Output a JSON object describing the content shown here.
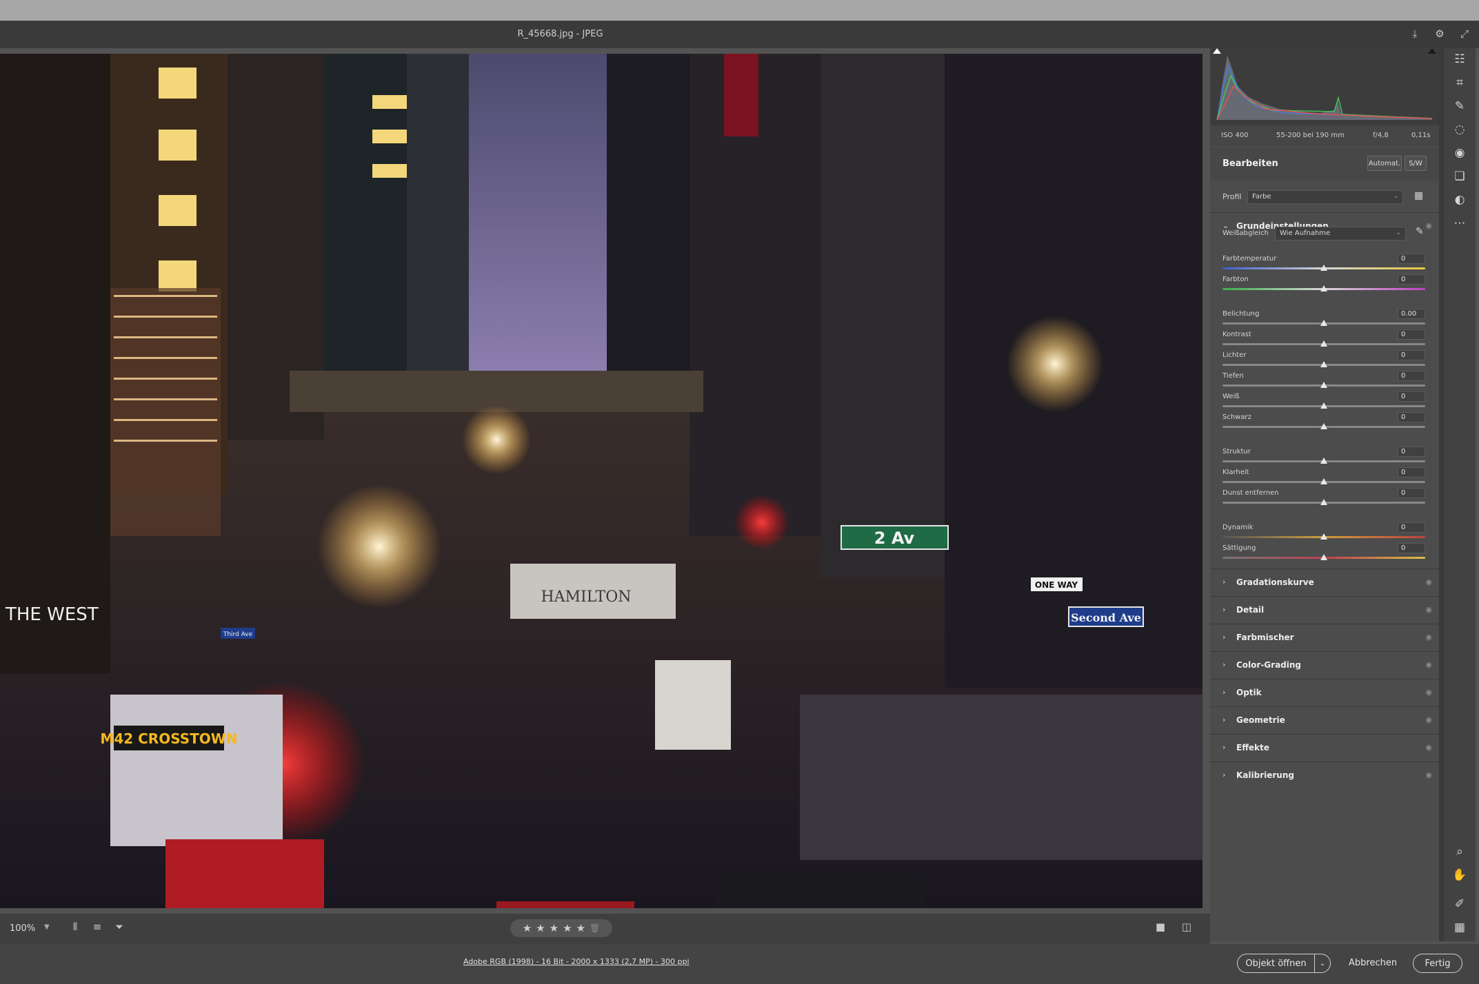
{
  "window": {
    "title": "R_45668.jpg - JPEG",
    "icons": [
      "save-icon",
      "gear-icon",
      "expand-icon"
    ]
  },
  "photo": {
    "signs": {
      "street": "2 Av",
      "avenue": "Second Ave",
      "bus": "M42 CROSSTOWN",
      "oneway": "ONE WAY",
      "bus_company": "HAMILTON",
      "third_ave": "Third Ave",
      "store": "THE WEST"
    }
  },
  "bottom_toolbar": {
    "zoom": "100%",
    "icons": [
      "filmstrip-icon",
      "sort-icon",
      "filter-icon",
      "single-view-icon",
      "compare-icon"
    ],
    "rating": {
      "max": 5,
      "value": 0
    }
  },
  "footer": {
    "info": "Adobe RGB (1998) - 16 Bit - 2000 x 1333 (2,7 MP) - 300 ppi",
    "open": "Objekt öffnen",
    "cancel": "Abbrechen",
    "done": "Fertig"
  },
  "exif": {
    "iso": "ISO 400",
    "lens": "55-200 bei 190 mm",
    "aperture": "f/4,8",
    "shutter": "0,11s"
  },
  "edit": {
    "title": "Bearbeiten",
    "auto": "Automat.",
    "bw": "S/W",
    "profile_label": "Profil",
    "profile_value": "Farbe",
    "basic": {
      "title": "Grundeinstellungen",
      "wb_label": "Weißabgleich",
      "wb_value": "Wie Aufnahme",
      "sliders": [
        {
          "label": "Farbtemperatur",
          "value": "0"
        },
        {
          "label": "Farbton",
          "value": "0"
        },
        {
          "label": "Belichtung",
          "value": "0.00"
        },
        {
          "label": "Kontrast",
          "value": "0"
        },
        {
          "label": "Lichter",
          "value": "0"
        },
        {
          "label": "Tiefen",
          "value": "0"
        },
        {
          "label": "Weiß",
          "value": "0"
        },
        {
          "label": "Schwarz",
          "value": "0"
        },
        {
          "label": "Struktur",
          "value": "0"
        },
        {
          "label": "Klarheit",
          "value": "0"
        },
        {
          "label": "Dunst entfernen",
          "value": "0"
        },
        {
          "label": "Dynamik",
          "value": "0"
        },
        {
          "label": "Sättigung",
          "value": "0"
        }
      ]
    },
    "sections": [
      "Gradationskurve",
      "Detail",
      "Farbmischer",
      "Color-Grading",
      "Optik",
      "Geometrie",
      "Effekte",
      "Kalibrierung"
    ]
  },
  "tools": [
    "edit-icon",
    "crop-icon",
    "healing-icon",
    "masking-icon",
    "red-eye-icon",
    "presets-icon",
    "snapshots-icon",
    "more-icon",
    "zoom-icon",
    "hand-icon",
    "color-sampler-icon",
    "grid-icon"
  ]
}
